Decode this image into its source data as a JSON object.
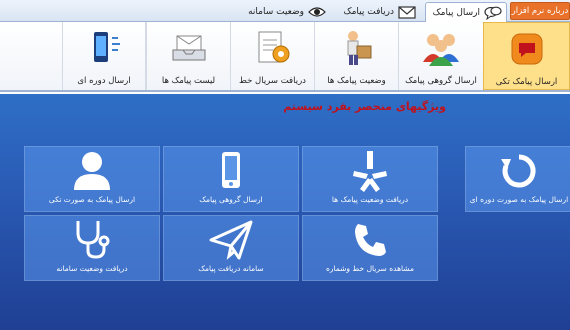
{
  "tabs": {
    "about": "درباره نرم افزار",
    "send_sms": "ارسال پیامک",
    "receive_sms": "دریافت پیامک",
    "system_status": "وضعیت سامانه"
  },
  "ribbon": {
    "single_send": "ارسال پیامک تکی",
    "group_send": "ارسال گروهی پیامک",
    "sms_status": "وضعیت پیامک ها",
    "receive_line": "دریافت سریال خط",
    "sms_list": "لیست پیامک ها",
    "periodic_send": "ارسال دوره ای"
  },
  "main": {
    "title": "ویژگیهای منحصر بفرد سیستم",
    "tiles": {
      "periodic": "ارسال پیامک به صورت دوره ای",
      "status_check": "دریافت وضعیت پیامک ها",
      "group": "ارسال گروهی پیامک",
      "single": "ارسال پیامک به صورت تکی",
      "serial": "مشاهده سریال خط وشماره",
      "receive": "سامانه دریافت پیامک",
      "system_status": "دریافت وضعیت سامانه"
    }
  },
  "colors": {
    "accent_orange": "#e9722b",
    "title_red": "#c0121d",
    "panel_blue": "#2a5bb5"
  }
}
